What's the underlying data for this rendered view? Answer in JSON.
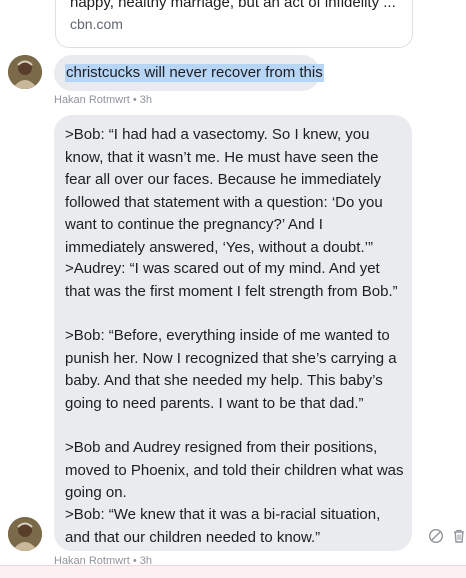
{
  "link_preview": {
    "description": "happy, healthy marriage, but an act of infidelity ...",
    "domain": "cbn.com"
  },
  "messages": [
    {
      "text": "christcucks will never recover from this",
      "author": "Hakan Rotmwrt",
      "time": "3h",
      "selected": true
    },
    {
      "paragraphs": [
        ">Bob: “I had had a vasectomy. So I knew, you know, that it wasn’t me. He must have seen the fear all over our faces. Because he immediately followed that statement with a question: ‘Do you want to continue the pregnancy?’ And I immediately answered, ‘Yes, without a doubt.’”",
        ">Audrey: “I was scared out of my mind. And yet that was the first moment I felt strength from Bob.”",
        ">Bob: “Before, everything inside of me wanted to punish her. Now I recognized that she’s carrying a baby. And that she needed my help. This baby’s going to need parents. I want to be that dad.”",
        ">Bob and Audrey resigned from their positions, moved to Phoenix, and told their children what was going on.",
        ">Bob: “We knew that it was a bi-racial situation, and that our children needed to know.”"
      ],
      "author": "Hakan Rotmwrt",
      "time": "3h"
    }
  ],
  "meta_separator": " • ",
  "icons": {
    "avatar": "user-avatar-photo",
    "remove": "circle-slash-icon",
    "delete": "trash-icon"
  },
  "colors": {
    "bubble": "#e9ebee",
    "selection": "#b7d5f5",
    "meta": "#90949c"
  }
}
